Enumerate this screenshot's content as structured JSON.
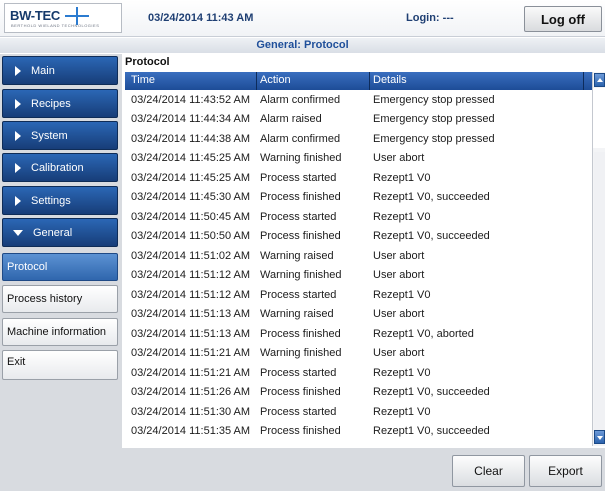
{
  "header": {
    "logo_text": "BW-TEC",
    "logo_sub": "BERTHOLD WIELAND TECHNOLOGIES",
    "datetime": "03/24/2014 11:43 AM",
    "login": "Login: ---",
    "logoff_label": "Log off"
  },
  "section_title": "General: Protocol",
  "sidebar": {
    "items": [
      {
        "label": "Main",
        "icon": "chevron-right-icon"
      },
      {
        "label": "Recipes",
        "icon": "chevron-right-icon"
      },
      {
        "label": "System",
        "icon": "chevron-right-icon"
      },
      {
        "label": "Calibration",
        "icon": "chevron-right-icon"
      },
      {
        "label": "Settings",
        "icon": "chevron-right-icon"
      },
      {
        "label": "General",
        "icon": "chevron-down-icon"
      }
    ],
    "subitems": [
      {
        "label": "Protocol",
        "active": true
      },
      {
        "label": "Process history",
        "active": false
      },
      {
        "label": "Machine information",
        "active": false
      },
      {
        "label": "Exit",
        "active": false
      }
    ]
  },
  "protocol": {
    "title": "Protocol",
    "columns": [
      "Time",
      "Action",
      "Details"
    ],
    "rows": [
      [
        "03/24/2014 11:43:52 AM",
        "Alarm confirmed",
        "Emergency stop pressed"
      ],
      [
        "03/24/2014 11:44:34 AM",
        "Alarm raised",
        "Emergency stop pressed"
      ],
      [
        "03/24/2014 11:44:38 AM",
        "Alarm confirmed",
        "Emergency stop pressed"
      ],
      [
        "03/24/2014 11:45:25 AM",
        "Warning finished",
        "User abort"
      ],
      [
        "03/24/2014 11:45:25 AM",
        "Process started",
        "Rezept1 V0"
      ],
      [
        "03/24/2014 11:45:30 AM",
        "Process finished",
        "Rezept1 V0, succeeded"
      ],
      [
        "03/24/2014 11:50:45 AM",
        "Process started",
        "Rezept1 V0"
      ],
      [
        "03/24/2014 11:50:50 AM",
        "Process finished",
        "Rezept1 V0, succeeded"
      ],
      [
        "03/24/2014 11:51:02 AM",
        "Warning raised",
        "User abort"
      ],
      [
        "03/24/2014 11:51:12 AM",
        "Warning finished",
        "User abort"
      ],
      [
        "03/24/2014 11:51:12 AM",
        "Process started",
        "Rezept1 V0"
      ],
      [
        "03/24/2014 11:51:13 AM",
        "Warning raised",
        "User abort"
      ],
      [
        "03/24/2014 11:51:13 AM",
        "Process finished",
        "Rezept1 V0, aborted"
      ],
      [
        "03/24/2014 11:51:21 AM",
        "Warning finished",
        "User abort"
      ],
      [
        "03/24/2014 11:51:21 AM",
        "Process started",
        "Rezept1 V0"
      ],
      [
        "03/24/2014 11:51:26 AM",
        "Process finished",
        "Rezept1 V0, succeeded"
      ],
      [
        "03/24/2014 11:51:30 AM",
        "Process started",
        "Rezept1 V0"
      ],
      [
        "03/24/2014 11:51:35 AM",
        "Process finished",
        "Rezept1 V0, succeeded"
      ]
    ]
  },
  "actions": {
    "clear_label": "Clear",
    "export_label": "Export"
  },
  "colors": {
    "nav_blue": "#1f4f9a",
    "active_blue": "#2f66ad",
    "header_blue": "#1d4c97"
  }
}
